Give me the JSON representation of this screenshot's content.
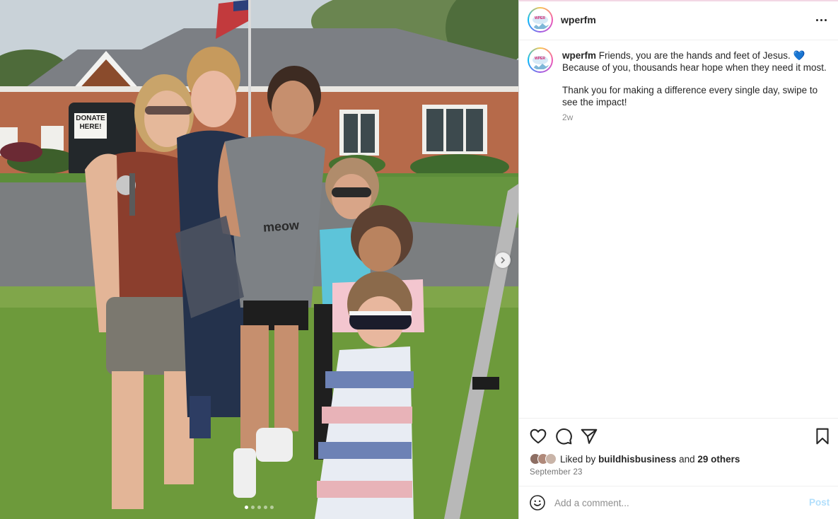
{
  "post": {
    "username": "wperfm",
    "avatar_logo_text": "WPER",
    "avatar_icon": "wperfm-avatar-icon",
    "more_icon": "more-options-icon",
    "photo": {
      "sign_line1": "DONATE",
      "sign_line2": "HERE!",
      "shirt_text": "meow",
      "next_icon": "chevron-right-icon",
      "carousel_count": 5,
      "carousel_active_index": 0
    },
    "caption": {
      "username": "wperfm",
      "line1": "Friends, you are the hands and feet of Jesus.",
      "heart": "💙",
      "line2": "Because of you, thousands hear hope when they need it most.",
      "line3": "Thank you for making a difference every single day, swipe to see the impact!",
      "time_ago": "2w"
    },
    "actions": {
      "like_icon": "heart-icon",
      "comment_icon": "comment-icon",
      "share_icon": "share-icon",
      "save_icon": "bookmark-icon"
    },
    "likes": {
      "prefix": "Liked by",
      "user": "buildhisbusiness",
      "connector": "and",
      "others": "29 others"
    },
    "date": "September 23",
    "comment": {
      "emoji_icon": "emoji-icon",
      "placeholder": "Add a comment...",
      "post_label": "Post"
    }
  },
  "colors": {
    "link_blue_disabled": "#b2dffc",
    "text_primary": "#262626",
    "text_secondary": "#8e8e8e",
    "border": "#dbdbdb"
  }
}
